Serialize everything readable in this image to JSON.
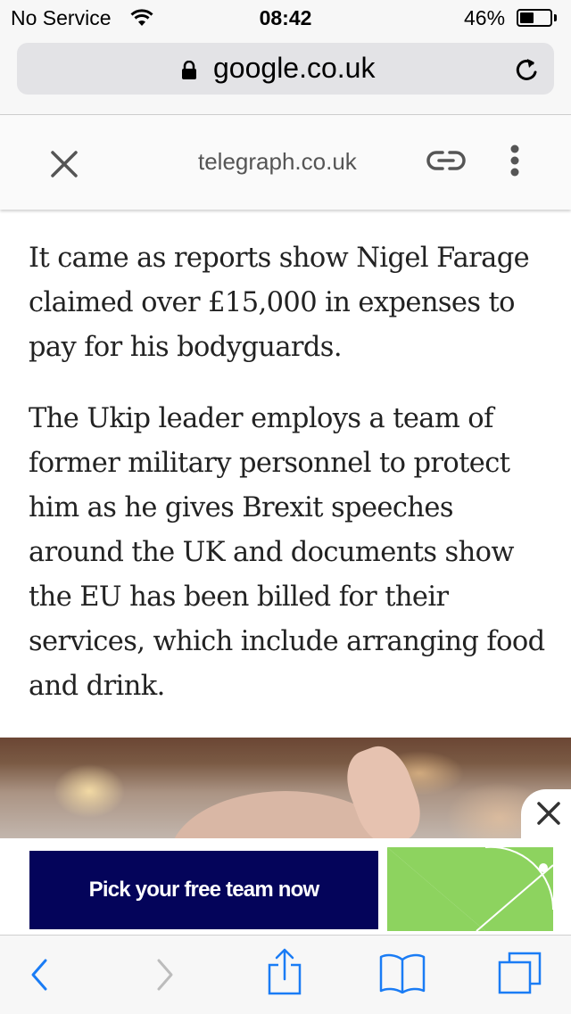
{
  "status_bar": {
    "carrier": "No Service",
    "time": "08:42",
    "battery_percent": "46%",
    "battery_level": 0.46,
    "icons": [
      "wifi-icon",
      "battery-icon"
    ]
  },
  "address_bar": {
    "url": "google.co.uk",
    "icons": [
      "lock-icon",
      "reload-icon"
    ]
  },
  "amp_header": {
    "domain": "telegraph.co.uk",
    "icons": [
      "close-icon",
      "link-icon",
      "more-vertical-icon"
    ]
  },
  "article": {
    "paragraphs": [
      "It came as reports show Nigel Farage claimed over £15,000 in expenses to pay for his bodyguards.",
      "The Ukip leader employs a team of former military personnel to protect him as he gives Brexit speeches around the UK and documents show the EU has been billed for their services, which include arranging food and drink."
    ]
  },
  "ad": {
    "text": "Pick your free team now",
    "colors": {
      "box": "#04045a",
      "pitch": "#8dd35f"
    },
    "icons": [
      "close-icon"
    ]
  },
  "toolbar": {
    "icons": [
      "back-icon",
      "forward-icon",
      "share-icon",
      "bookmarks-icon",
      "tabs-icon"
    ],
    "accent": "#1a7cf5"
  }
}
